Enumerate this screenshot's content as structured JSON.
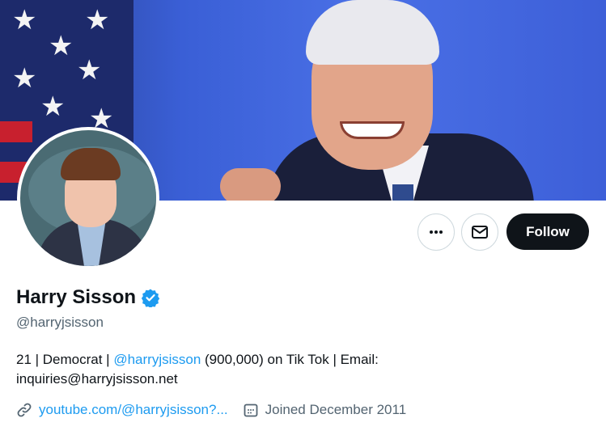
{
  "profile": {
    "name": "Harry Sisson",
    "handle": "@harryjsisson",
    "verified": true
  },
  "actions": {
    "more_icon": "more-icon",
    "message_icon": "mail-icon",
    "follow_label": "Follow"
  },
  "bio": {
    "part1": "21 | Democrat | ",
    "mention": "@harryjsisson",
    "part2": " (900,000) on Tik Tok | Email:",
    "line2": "inquiries@harryjsisson.net"
  },
  "meta": {
    "link_text": "youtube.com/@harryjsisson?...",
    "joined": "Joined December 2011",
    "link_icon": "link-icon",
    "calendar_icon": "calendar-icon"
  },
  "colors": {
    "accent": "#1d9bf0",
    "text": "#0f1419",
    "muted": "#536471",
    "follow_bg": "#0f1419"
  }
}
